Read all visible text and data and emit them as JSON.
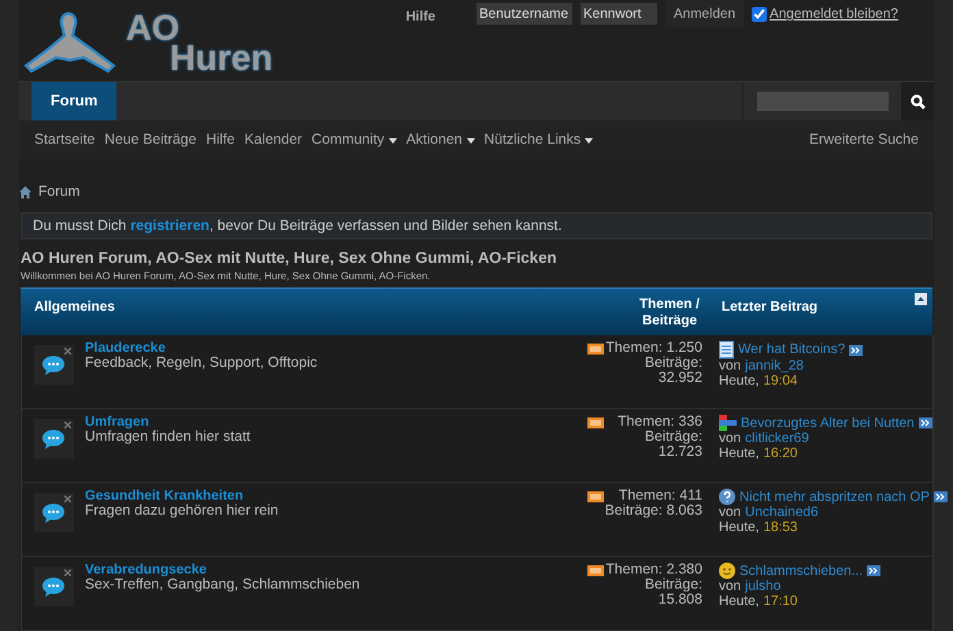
{
  "logo": {
    "line_1": "AO",
    "line_2": "Huren"
  },
  "top_bar": {
    "help": "Hilfe",
    "username_placeholder": "Benutzername",
    "password_placeholder": "Kennwort",
    "login": "Anmelden",
    "remember": {
      "label": "Angemeldet bleiben?",
      "checked": true
    }
  },
  "tabs": [
    {
      "label": "Forum",
      "selected": true
    }
  ],
  "subnav": [
    {
      "label": "Startseite",
      "dropdown": false
    },
    {
      "label": "Neue Beiträge",
      "dropdown": false
    },
    {
      "label": "Hilfe",
      "dropdown": false
    },
    {
      "label": "Kalender",
      "dropdown": false
    },
    {
      "label": "Community",
      "dropdown": true
    },
    {
      "label": "Aktionen",
      "dropdown": true
    },
    {
      "label": "Nützliche Links",
      "dropdown": true
    }
  ],
  "advanced_search": "Erweiterte Suche",
  "breadcrumb": "Forum",
  "notice": "Du musst Dich **registrieren**, bevor Du Beiträge verfassen und Bilder sehen kannst.",
  "page_title": "AO Huren Forum, AO-Sex mit Nutte, Hure, Sex Ohne Gummi, AO-Ficken",
  "page_subtitle": "Willkommen bei AO Huren Forum, AO-Sex mit Nutte, Hure, Sex Ohne Gummi, AO-Ficken.",
  "table": {
    "category": "Allgemeines",
    "col_stats": [
      "Themen /",
      "Beiträge"
    ],
    "col_last": "Letzter Beitrag",
    "rows": [
      {
        "name": "Plauderecke",
        "description": "Feedback, Regeln, Support, Offtopic",
        "stats": [
          "Themen: 1.250",
          "Beiträge:",
          "32.952"
        ],
        "last": {
          "kind": "document",
          "title": "Wer hat Bitcoins?",
          "by": "von",
          "author": "jannik_28",
          "day": "Heute,",
          "time": "19:04"
        }
      },
      {
        "name": "Umfragen",
        "description": "Umfragen finden hier statt",
        "stats": [
          "Themen: 336",
          "Beiträge:",
          "12.723"
        ],
        "last": {
          "kind": "flag",
          "title": "Bevorzugtes Alter bei Nutten",
          "by": "von",
          "author": "clitlicker69",
          "day": "Heute,",
          "time": "16:20"
        }
      },
      {
        "name": "Gesundheit Krankheiten",
        "description": "Fragen dazu gehören hier rein",
        "stats": [
          "Themen: 411",
          "Beiträge: 8.063"
        ],
        "last": {
          "kind": "question",
          "title": "Nicht mehr abspritzen nach OP",
          "by": "von",
          "author": "Unchained6",
          "day": "Heute,",
          "time": "18:53"
        }
      },
      {
        "name": "Verabredungsecke",
        "description": "Sex-Treffen, Gangbang, Schlammschieben",
        "stats": [
          "Themen: 2.380",
          "Beiträge:",
          "15.808"
        ],
        "last": {
          "kind": "smiley",
          "title": "Schlammschieben...",
          "by": "von",
          "author": "julsho",
          "day": "Heute,",
          "time": "17:10"
        }
      }
    ]
  }
}
